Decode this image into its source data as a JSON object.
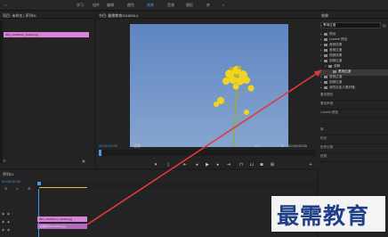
{
  "menu": {
    "items": [
      "学习",
      "组件",
      "编辑",
      "颜色",
      "效果",
      "音频",
      "图形",
      "库"
    ],
    "active_index": 4
  },
  "project_panel": {
    "title": "项目: 未命名 | 序列01",
    "clip_label": "IMG_20180514_104430.jpg"
  },
  "program_monitor": {
    "title": "节目: 最需教育20180514",
    "timecode_left": "00:00:00:00",
    "fit_label": "适合",
    "ratio_label": "1/2",
    "timecode_right": "00:00:05:00",
    "transport": [
      "标记入点",
      "标记出点",
      "转到入点",
      "后退",
      "播放",
      "前进",
      "转到出点",
      "插入",
      "覆盖",
      "导出帧",
      "按钮编辑"
    ]
  },
  "effects_panel": {
    "title": "效果",
    "search_value": "黑场过渡",
    "tree": [
      {
        "label": "预设",
        "depth": 0,
        "type": "folder"
      },
      {
        "label": "Lumetri 预设",
        "depth": 0,
        "type": "folder"
      },
      {
        "label": "音频效果",
        "depth": 0,
        "type": "folder"
      },
      {
        "label": "音频过渡",
        "depth": 0,
        "type": "folder"
      },
      {
        "label": "视频效果",
        "depth": 0,
        "type": "folder"
      },
      {
        "label": "视频过渡",
        "depth": 0,
        "type": "folder",
        "expanded": true
      },
      {
        "label": "溶解",
        "depth": 1,
        "type": "folder",
        "expanded": true
      },
      {
        "label": "黑场过渡",
        "depth": 2,
        "type": "item",
        "selected": true
      },
      {
        "label": "音频过渡",
        "depth": 0,
        "type": "folder"
      },
      {
        "label": "视频过渡",
        "depth": 0,
        "type": "folder"
      },
      {
        "label": "我的自定义素材箱",
        "depth": 0,
        "type": "folder"
      }
    ]
  },
  "side_panels": [
    "基本图形",
    "基本声音",
    "Lumetri 颜色",
    "库",
    "标记",
    "历史记录",
    "信息"
  ],
  "timeline": {
    "title": "序列01",
    "timecode": "00:00:00:00",
    "tracks": [
      "V3",
      "V2",
      "V1",
      "A1",
      "A2",
      "A3"
    ],
    "clip_top": "IMG_20180514_104430.jpg",
    "clip_bottom": "最需教育20180514.jpg"
  },
  "watermark": "最需教育",
  "colors": {
    "accent": "#4a98e8",
    "clip": "#d882d8",
    "arrow": "#e23a3a",
    "sky": "#6f93c8",
    "flower": "#f0d420"
  }
}
